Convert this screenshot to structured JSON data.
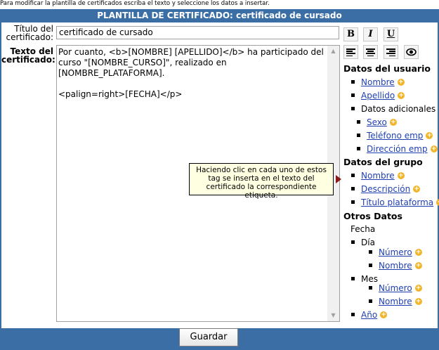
{
  "instructions": "Para modificar la plantilla de certificados escriba el texto y seleccione los datos a insertar.",
  "header": {
    "title": "PLANTILLA DE CERTIFICADO: certificado de cursado"
  },
  "form": {
    "title_label_line1": "Título del",
    "title_label_line2": "certificado:",
    "title_value": "certificado de cursado",
    "text_label_line1": "Texto del",
    "text_label_line2": "certificado:",
    "text_value": "Por cuanto, <b>[NOMBRE] [APELLIDO]</b> ha participado del curso \"[NOMBRE_CURSO]\", realizado en [NOMBRE_PLATAFORMA].\n\n<palign=right>[FECHA]</p>"
  },
  "toolbar": {
    "bold": "B",
    "italic": "I",
    "underline": "U"
  },
  "panel": {
    "user_section": "Datos del usuario",
    "user_name": "Nombre",
    "user_lastname": "Apellido",
    "user_extra": "Datos adicionales",
    "user_sex": "Sexo",
    "user_phone": "Teléfono emp",
    "user_address": "Dirección emp",
    "group_section": "Datos del grupo",
    "group_name": "Nombre",
    "group_desc": "Descripción",
    "group_platform": "Título plataforma",
    "other_section": "Otros Datos",
    "other_date": "Fecha",
    "day": "Día",
    "day_number": "Número",
    "day_name": "Nombre",
    "month": "Mes",
    "month_number": "Número",
    "month_name": "Nombre",
    "year": "Año"
  },
  "tooltip": "Haciendo clic en cada uno de estos tag se inserta en el texto del certificado la correspondiente etiqueta.",
  "save_label": "Guardar",
  "colors": {
    "frame": "#3a6ea5",
    "link": "#1f3fb0",
    "plus": "#f1b52a",
    "tooltip_bg": "#ffffe1"
  }
}
